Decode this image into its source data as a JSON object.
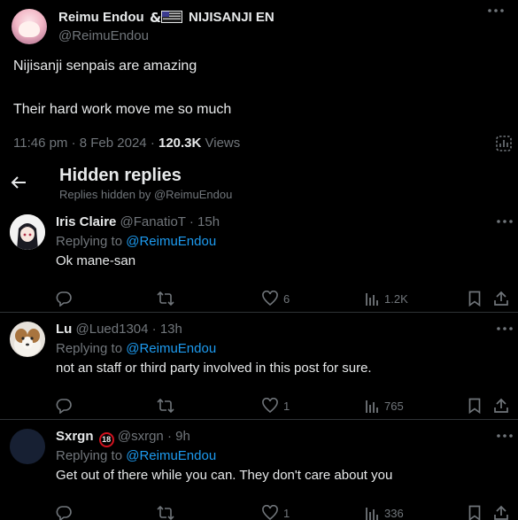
{
  "tweet": {
    "author_name": "Reimu Endou",
    "author_suffix": "NIJISANJI EN",
    "author_handle": "@ReimuEndou",
    "text_line1": "Nijisanji senpais are amazing",
    "text_line2": "Their hard work move me so much",
    "time": "11:46 pm · 8 Feb 2024 · ",
    "views_count": "120.3K",
    "views_label": " Views"
  },
  "hidden_replies": {
    "title": "Hidden replies",
    "subtitle": "Replies hidden by @ReimuEndou"
  },
  "replies": [
    {
      "name": "Iris Claire",
      "handle": "@FanatioT",
      "time": "15h",
      "replying_prefix": "Replying to ",
      "replying_to": "@ReimuEndou",
      "text": "Ok mane-san",
      "reply_count": "",
      "retweet_count": "",
      "like_count": "6",
      "view_count": "1.2K"
    },
    {
      "name": "Lu",
      "handle": "@Lued1304",
      "time": "13h",
      "replying_prefix": "Replying to ",
      "replying_to": "@ReimuEndou",
      "text": "not an staff or third party involved in this post for sure.",
      "reply_count": "",
      "retweet_count": "",
      "like_count": "1",
      "view_count": "765"
    },
    {
      "name": "Sxrgn",
      "badge": "18",
      "handle": "@sxrgn",
      "time": "9h",
      "replying_prefix": "Replying to ",
      "replying_to": "@ReimuEndou",
      "text": "Get out of there while you can. They don't care about you",
      "reply_count": "",
      "retweet_count": "",
      "like_count": "1",
      "view_count": "336"
    }
  ],
  "colors": {
    "background": "#000000",
    "text": "#e7e9ea",
    "muted": "#71767b",
    "link": "#1d9bf0",
    "divider": "#2f3336"
  },
  "icons": [
    "more-icon",
    "analytics-icon",
    "back-arrow-icon",
    "reply-icon",
    "retweet-icon",
    "like-icon",
    "views-icon",
    "bookmark-icon",
    "share-icon",
    "flag-emoji-icon"
  ]
}
